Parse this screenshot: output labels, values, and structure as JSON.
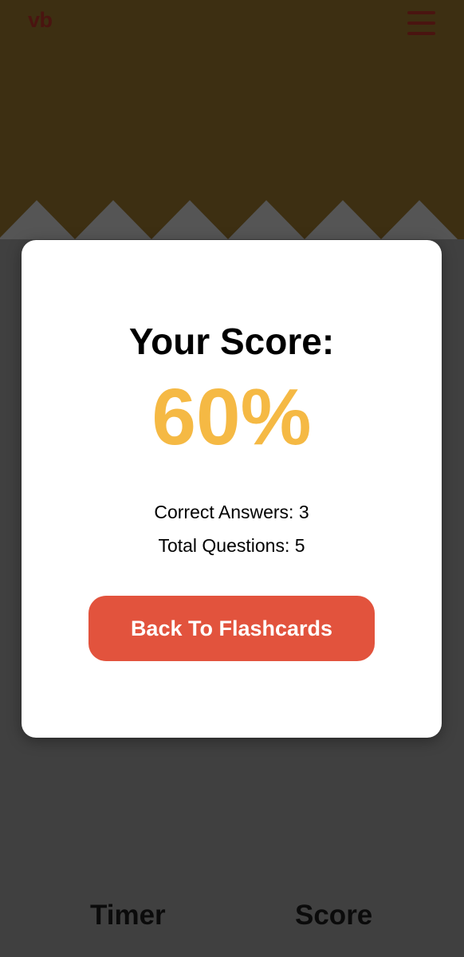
{
  "header": {
    "logo_text": "vb",
    "menu_icon": "hamburger-menu-icon",
    "background_color": "#3d2f12",
    "zigzag_color": "#555555"
  },
  "result_modal": {
    "title": "Your Score:",
    "score_percent": "60%",
    "correct_answers_text": "Correct Answers: 3",
    "total_questions_text": "Total Questions: 5",
    "back_button_label": "Back To Flashcards",
    "score_color": "#f5b944",
    "button_color": "#e2533d"
  },
  "bottom_tabs": {
    "timer_label": "Timer",
    "score_label": "Score"
  }
}
